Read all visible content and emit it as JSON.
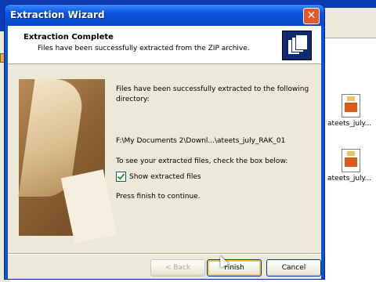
{
  "dialog": {
    "title": "Extraction Wizard",
    "close_glyph": "✕",
    "header": {
      "title": "Extraction Complete",
      "subtitle": "Files have been successfully extracted from the ZIP archive."
    },
    "body": {
      "message": "Files have been successfully extracted to the following directory:",
      "path": "F:\\My Documents 2\\Downl...\\ateets_july_RAK_01",
      "check_hint": "To see your extracted files, check the box below:",
      "checkbox_label": "Show extracted files",
      "checkbox_checked": true,
      "finish_hint": "Press finish to continue."
    },
    "buttons": {
      "back": "< Back",
      "finish": "Finish",
      "cancel": "Cancel"
    }
  },
  "background_files": [
    {
      "name": "ateets_july..."
    },
    {
      "name": "ateets_july..."
    }
  ],
  "colors": {
    "titlebar": "#0a54e0",
    "client": "#ece9d8",
    "close_button": "#e25a2b"
  }
}
